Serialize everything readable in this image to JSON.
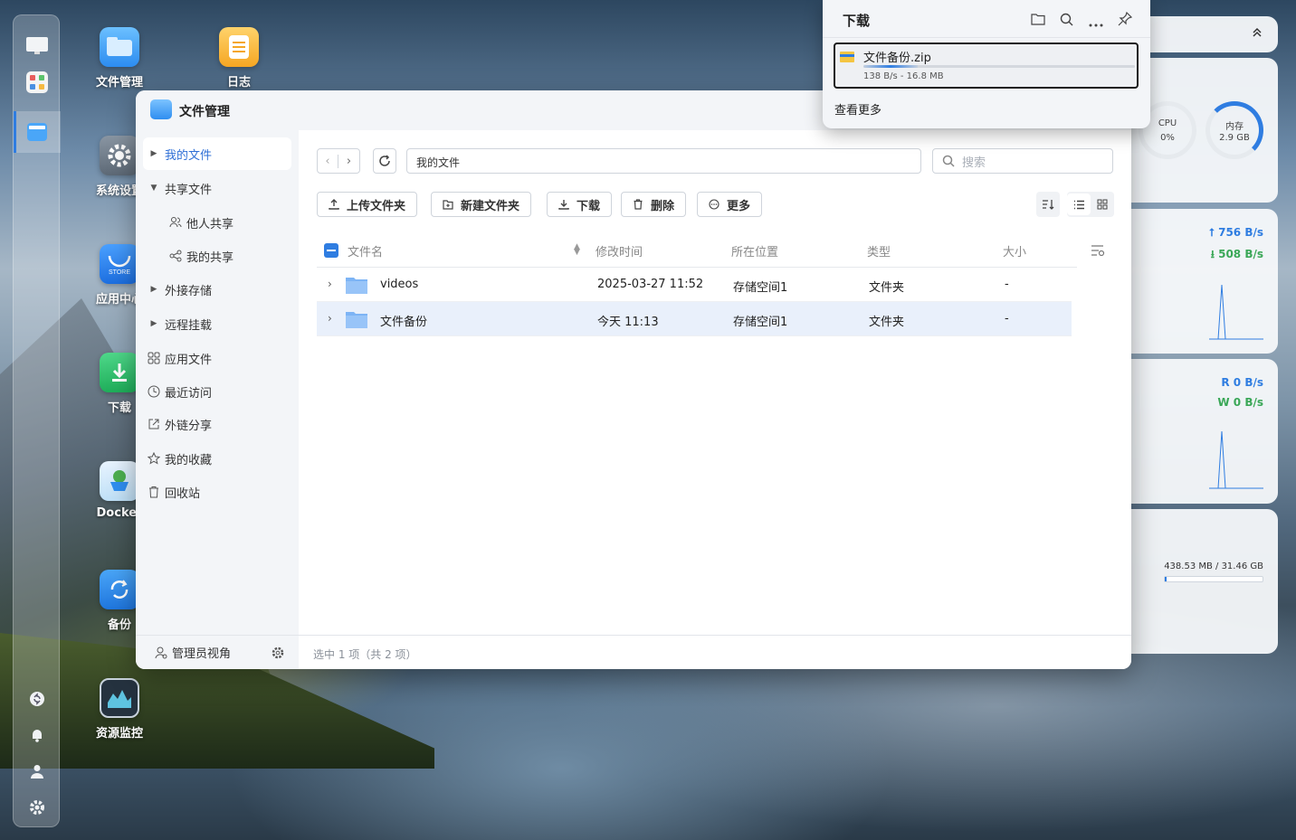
{
  "desktop_icons": [
    {
      "label": "文件管理",
      "icon": "file-manager-icon"
    },
    {
      "label": "日志",
      "icon": "notes-icon"
    },
    {
      "label": "系统设置",
      "icon": "settings-icon"
    },
    {
      "label": "应用中心",
      "icon": "app-store-icon",
      "badge": "STORE"
    },
    {
      "label": "下载",
      "icon": "download-icon"
    },
    {
      "label": "Docker",
      "icon": "docker-icon"
    },
    {
      "label": "备份",
      "icon": "backup-icon"
    },
    {
      "label": "资源监控",
      "icon": "resource-monitor-icon"
    }
  ],
  "window": {
    "title": "文件管理",
    "sidebar": {
      "items": [
        {
          "label": "我的文件",
          "icon": "caret-right-icon",
          "active": true
        },
        {
          "label": "共享文件",
          "icon": "caret-down-icon"
        },
        {
          "label": "他人共享",
          "icon": "users-icon"
        },
        {
          "label": "我的共享",
          "icon": "share-icon"
        },
        {
          "label": "外接存储",
          "icon": "caret-right-icon"
        },
        {
          "label": "远程挂载",
          "icon": "caret-right-icon"
        },
        {
          "label": "应用文件",
          "icon": "apps-grid-icon"
        },
        {
          "label": "最近访问",
          "icon": "clock-icon"
        },
        {
          "label": "外链分享",
          "icon": "external-share-icon"
        },
        {
          "label": "我的收藏",
          "icon": "star-icon"
        },
        {
          "label": "回收站",
          "icon": "trash-icon"
        }
      ],
      "footer_label": "管理员视角"
    },
    "path": "我的文件",
    "search_placeholder": "搜索",
    "toolbar": {
      "upload": "上传文件夹",
      "new_folder": "新建文件夹",
      "download": "下载",
      "delete": "删除",
      "more": "更多"
    },
    "table": {
      "columns": [
        "文件名",
        "修改时间",
        "所在位置",
        "类型",
        "大小"
      ],
      "rows": [
        {
          "name": "videos",
          "modified": "2025-03-27 11:52",
          "location": "存储空间1",
          "type": "文件夹",
          "size": "-",
          "selected": false
        },
        {
          "name": "文件备份",
          "modified": "今天 11:13",
          "location": "存储空间1",
          "type": "文件夹",
          "size": "-",
          "selected": true
        }
      ]
    },
    "status": "选中 1 项（共 2 项）"
  },
  "download_popup": {
    "title": "下载",
    "item": {
      "name": "文件备份.zip",
      "meta": "138 B/s - 16.8 MB",
      "progress": 0.2
    },
    "more": "查看更多"
  },
  "widgets": {
    "cpu": {
      "label": "CPU",
      "value": "0%"
    },
    "memory": {
      "label": "内存",
      "value": "2.9 GB"
    },
    "network": {
      "up": "756 B/s",
      "down": "508 B/s"
    },
    "disk_io": {
      "read": "R  0 B/s",
      "write": "W  0 B/s"
    },
    "storage": {
      "text": "438.53 MB / 31.46 GB",
      "fraction": 0.014
    }
  },
  "colors": {
    "accent": "#2f7de1",
    "green": "#3aa757"
  }
}
